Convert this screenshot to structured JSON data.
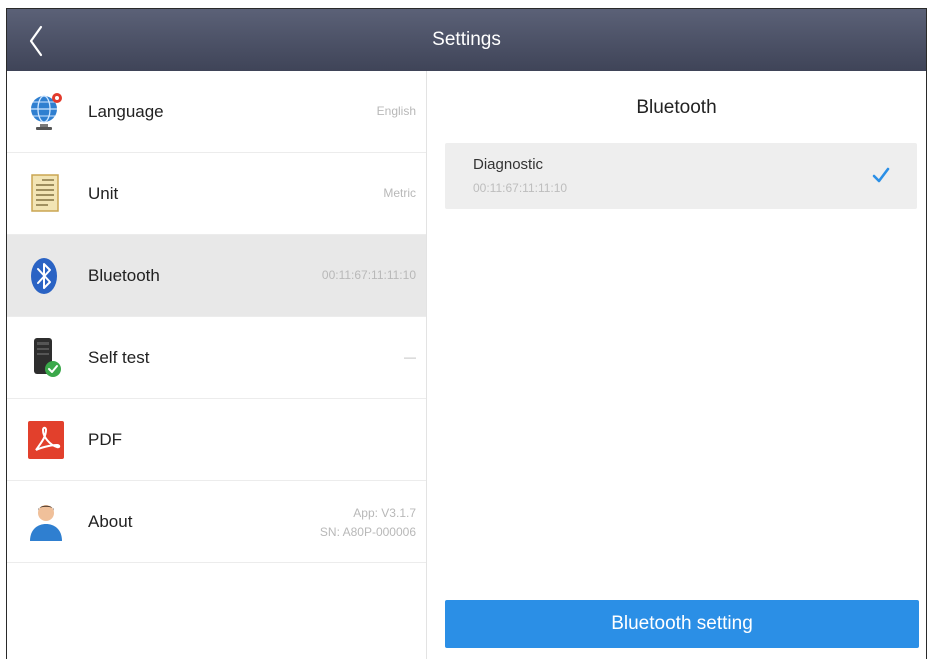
{
  "header": {
    "title": "Settings"
  },
  "settings": [
    {
      "label": "Language",
      "value": "English"
    },
    {
      "label": "Unit",
      "value": "Metric"
    },
    {
      "label": "Bluetooth",
      "value": "00:11:67:11:11:10"
    },
    {
      "label": "Self test",
      "value": "—"
    },
    {
      "label": "PDF",
      "value": ""
    },
    {
      "label": "About",
      "value_line1": "App: V3.1.7",
      "value_line2": "SN: A80P-000006"
    }
  ],
  "bluetooth_panel": {
    "title": "Bluetooth",
    "device": {
      "name": "Diagnostic",
      "address": "00:11:67:11:11:10",
      "selected": true
    },
    "button_label": "Bluetooth setting"
  },
  "colors": {
    "header_bg": "#4a4f64",
    "selected_row": "#e8e8e8",
    "accent": "#2b8fe6",
    "check": "#2b8fe6"
  }
}
